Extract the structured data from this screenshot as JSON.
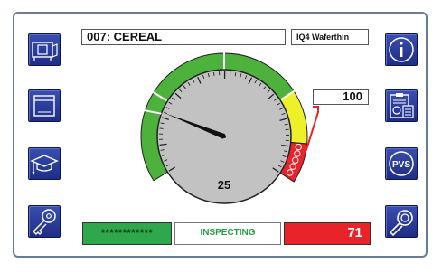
{
  "header": {
    "product": "007: CEREAL",
    "variant": "IQ4 Waferthin"
  },
  "gauge": {
    "center_value": "25",
    "needle_value": 25,
    "setpoint_label": "100",
    "zones": [
      {
        "name": "green",
        "color": "#4db23b"
      },
      {
        "name": "yellow",
        "color": "#eef02a"
      },
      {
        "name": "red",
        "color": "#e8232a"
      }
    ]
  },
  "footer": {
    "password": "************",
    "status": "INSPECTING",
    "reject_count": "71"
  },
  "left_buttons": [
    {
      "icon": "detector-machine-icon"
    },
    {
      "icon": "box-icon"
    },
    {
      "icon": "graduation-cap-icon"
    },
    {
      "icon": "key-icon"
    }
  ],
  "right_buttons": [
    {
      "icon": "info-icon"
    },
    {
      "icon": "clipboard-report-icon"
    },
    {
      "icon": "pvs-icon",
      "label": "PVS"
    },
    {
      "icon": "magnifier-icon"
    }
  ],
  "colors": {
    "accent_blue": "#243796",
    "frame": "#6a7c93",
    "dial": "#c2c2c2"
  }
}
